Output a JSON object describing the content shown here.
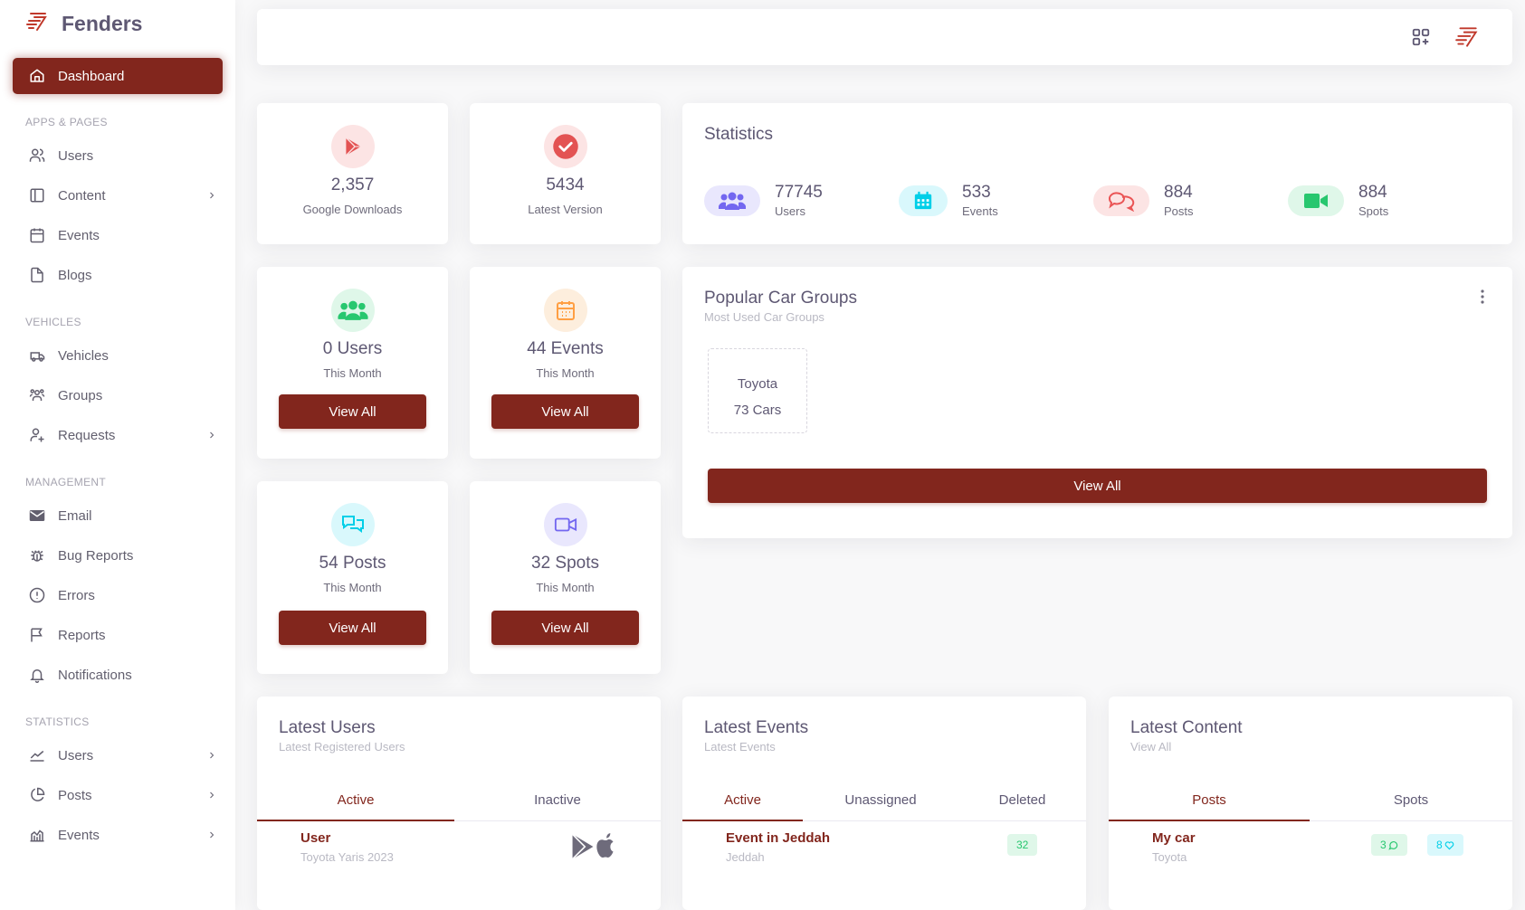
{
  "brand": {
    "name": "Fenders"
  },
  "sidebar": {
    "active": {
      "label": "Dashboard",
      "icon": "home-icon"
    },
    "sections": [
      {
        "header": "APPS & PAGES",
        "items": [
          {
            "label": "Users",
            "icon": "user-icon",
            "chevron": false
          },
          {
            "label": "Content",
            "icon": "sidebar-layout-icon",
            "chevron": true
          },
          {
            "label": "Events",
            "icon": "calendar-icon",
            "chevron": false
          },
          {
            "label": "Blogs",
            "icon": "file-icon",
            "chevron": false
          }
        ]
      },
      {
        "header": "VEHICLES",
        "items": [
          {
            "label": "Vehicles",
            "icon": "truck-icon",
            "chevron": false
          },
          {
            "label": "Groups",
            "icon": "users-group-icon",
            "chevron": false
          },
          {
            "label": "Requests",
            "icon": "user-plus-icon",
            "chevron": true
          }
        ]
      },
      {
        "header": "MANAGEMENT",
        "items": [
          {
            "label": "Email",
            "icon": "mail-icon",
            "chevron": false
          },
          {
            "label": "Bug Reports",
            "icon": "bug-icon",
            "chevron": false
          },
          {
            "label": "Errors",
            "icon": "alert-circle-icon",
            "chevron": false
          },
          {
            "label": "Reports",
            "icon": "flag-icon",
            "chevron": false
          },
          {
            "label": "Notifications",
            "icon": "bell-icon",
            "chevron": false
          }
        ]
      },
      {
        "header": "STATISTICS",
        "items": [
          {
            "label": "Users",
            "icon": "trending-up-icon",
            "chevron": true
          },
          {
            "label": "Posts",
            "icon": "pie-chart-icon",
            "chevron": true
          },
          {
            "label": "Events",
            "icon": "bar-chart-icon",
            "chevron": true
          }
        ]
      }
    ]
  },
  "cards": {
    "downloads": {
      "value": "2,357",
      "label": "Google Downloads"
    },
    "version": {
      "value": "5434",
      "label": "Latest Version"
    },
    "users_month": {
      "value": "0 Users",
      "label": "This Month",
      "button": "View All"
    },
    "events_month": {
      "value": "44 Events",
      "label": "This Month",
      "button": "View All"
    },
    "posts_month": {
      "value": "54 Posts",
      "label": "This Month",
      "button": "View All"
    },
    "spots_month": {
      "value": "32 Spots",
      "label": "This Month",
      "button": "View All"
    }
  },
  "statistics": {
    "title": "Statistics",
    "items": [
      {
        "value": "77745",
        "label": "Users",
        "icon": "users-icon",
        "color": "#7367f0",
        "bg": "#e9e7fd"
      },
      {
        "value": "533",
        "label": "Events",
        "icon": "calendar-icon",
        "color": "#00cfe8",
        "bg": "#d9f8fc"
      },
      {
        "value": "884",
        "label": "Posts",
        "icon": "chat-bubbles-icon",
        "color": "#ea5455",
        "bg": "#fce4e4"
      },
      {
        "value": "884",
        "label": "Spots",
        "icon": "video-icon",
        "color": "#28c76f",
        "bg": "#dff7e9"
      }
    ]
  },
  "popular_groups": {
    "title": "Popular Car Groups",
    "subtitle": "Most Used Car Groups",
    "group": {
      "name": "Toyota",
      "count": "73 Cars"
    },
    "button": "View All"
  },
  "latest_users": {
    "title": "Latest Users",
    "subtitle": "Latest Registered Users",
    "tabs": [
      "Active",
      "Inactive"
    ],
    "row": {
      "name": "User",
      "detail": "Toyota Yaris 2023"
    }
  },
  "latest_events": {
    "title": "Latest Events",
    "subtitle": "Latest Events",
    "tabs": [
      "Active",
      "Unassigned",
      "Deleted"
    ],
    "row": {
      "name": "Event in Jeddah",
      "detail": "Jeddah",
      "badge": "32"
    }
  },
  "latest_content": {
    "title": "Latest Content",
    "subtitle": "View All",
    "tabs": [
      "Posts",
      "Spots"
    ],
    "row": {
      "name": "My car",
      "detail": "Toyota",
      "comments": "3",
      "likes": "8"
    }
  },
  "colors": {
    "primary": "#82261d",
    "text": "#5e5873",
    "muted": "#b9b9c3"
  }
}
